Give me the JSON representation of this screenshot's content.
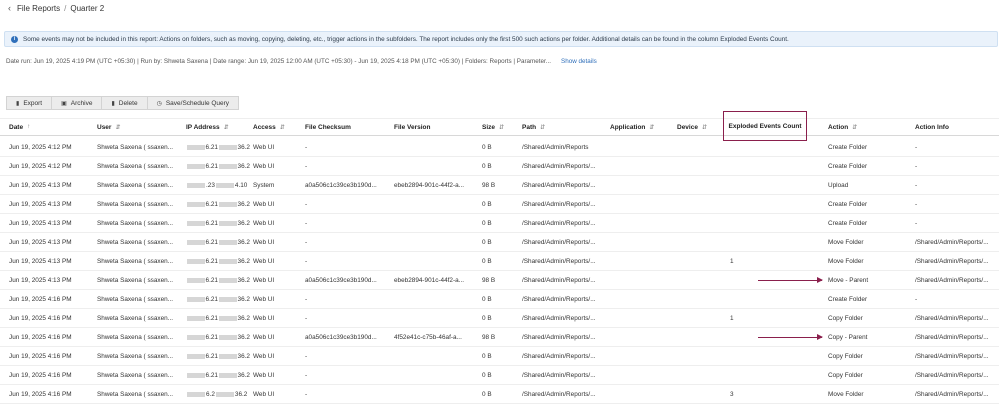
{
  "breadcrumb": {
    "back_icon": "chevron-left-icon",
    "parent": "File Reports",
    "separator": "/",
    "current": "Quarter 2"
  },
  "banner": {
    "icon": "info-icon",
    "text": "Some events may not be included in this report: Actions on folders, such as moving, copying, deleting, etc., trigger actions in the subfolders. The report includes only the first 500 such actions per folder. Additional details can be found in the column Exploded Events Count."
  },
  "run_info": {
    "text": "Date run: Jun 19, 2025 4:19 PM (UTC +05:30) | Run by: Shweta Saxena | Date range: Jun 19, 2025 12:00 AM (UTC +05:30) - Jun 19, 2025 4:18 PM (UTC +05:30) | Folders: Reports | Parameter...",
    "show_details": "Show details"
  },
  "toolbar": {
    "export": "Export",
    "archive": "Archive",
    "delete": "Delete",
    "save_schedule": "Save/Schedule Query"
  },
  "columns": {
    "date": "Date",
    "user": "User",
    "ip": "IP Address",
    "access": "Access",
    "checksum": "File Checksum",
    "version": "File Version",
    "size": "Size",
    "path": "Path",
    "application": "Application",
    "device": "Device",
    "exploded": "Exploded Events Count",
    "action": "Action",
    "action_info": "Action Info"
  },
  "rows": [
    {
      "date": "Jun 19, 2025 4:12 PM",
      "user": "Shweta Saxena ( ssaxen...",
      "ip_a": "6.21",
      "ip_b": "36.2",
      "access": "Web UI",
      "checksum": "-",
      "version": "",
      "size": "0 B",
      "path": "/Shared/Admin/Reports",
      "application": "",
      "device": "",
      "exploded": "",
      "action": "Create Folder",
      "action_info": "-"
    },
    {
      "date": "Jun 19, 2025 4:12 PM",
      "user": "Shweta Saxena ( ssaxen...",
      "ip_a": "6.21",
      "ip_b": "36.2",
      "access": "Web UI",
      "checksum": "-",
      "version": "",
      "size": "0 B",
      "path": "/Shared/Admin/Reports/...",
      "application": "",
      "device": "",
      "exploded": "",
      "action": "Create Folder",
      "action_info": "-"
    },
    {
      "date": "Jun 19, 2025 4:13 PM",
      "user": "Shweta Saxena ( ssaxen...",
      "ip_a": ".23",
      "ip_b": "4.10",
      "access": "System",
      "checksum": "a0a506c1c39ce3b190d...",
      "version": "ebeb2894-901c-44f2-a...",
      "size": "98 B",
      "path": "/Shared/Admin/Reports/...",
      "application": "",
      "device": "",
      "exploded": "",
      "action": "Upload",
      "action_info": "-"
    },
    {
      "date": "Jun 19, 2025 4:13 PM",
      "user": "Shweta Saxena ( ssaxen...",
      "ip_a": "6.21",
      "ip_b": "36.2",
      "access": "Web UI",
      "checksum": "-",
      "version": "",
      "size": "0 B",
      "path": "/Shared/Admin/Reports/...",
      "application": "",
      "device": "",
      "exploded": "",
      "action": "Create Folder",
      "action_info": "-"
    },
    {
      "date": "Jun 19, 2025 4:13 PM",
      "user": "Shweta Saxena ( ssaxen...",
      "ip_a": "6.21",
      "ip_b": "36.2",
      "access": "Web UI",
      "checksum": "-",
      "version": "",
      "size": "0 B",
      "path": "/Shared/Admin/Reports/...",
      "application": "",
      "device": "",
      "exploded": "",
      "action": "Create Folder",
      "action_info": "-"
    },
    {
      "date": "Jun 19, 2025 4:13 PM",
      "user": "Shweta Saxena ( ssaxen...",
      "ip_a": "6.21",
      "ip_b": "36.2",
      "access": "Web UI",
      "checksum": "-",
      "version": "",
      "size": "0 B",
      "path": "/Shared/Admin/Reports/...",
      "application": "",
      "device": "",
      "exploded": "",
      "action": "Move Folder",
      "action_info": "/Shared/Admin/Reports/..."
    },
    {
      "date": "Jun 19, 2025 4:13 PM",
      "user": "Shweta Saxena ( ssaxen...",
      "ip_a": "6.21",
      "ip_b": "36.2",
      "access": "Web UI",
      "checksum": "-",
      "version": "",
      "size": "0 B",
      "path": "/Shared/Admin/Reports/...",
      "application": "",
      "device": "",
      "exploded": "1",
      "action": "Move Folder",
      "action_info": "/Shared/Admin/Reports/..."
    },
    {
      "date": "Jun 19, 2025 4:13 PM",
      "user": "Shweta Saxena ( ssaxen...",
      "ip_a": "6.21",
      "ip_b": "36.2",
      "access": "Web UI",
      "checksum": "a0a506c1c39ce3b190d...",
      "version": "ebeb2894-901c-44f2-a...",
      "size": "98 B",
      "path": "/Shared/Admin/Reports/...",
      "application": "",
      "device": "",
      "exploded": "",
      "action": "Move - Parent",
      "action_info": "/Shared/Admin/Reports/..."
    },
    {
      "date": "Jun 19, 2025 4:16 PM",
      "user": "Shweta Saxena ( ssaxen...",
      "ip_a": "6.21",
      "ip_b": "36.2",
      "access": "Web UI",
      "checksum": "-",
      "version": "",
      "size": "0 B",
      "path": "/Shared/Admin/Reports/...",
      "application": "",
      "device": "",
      "exploded": "",
      "action": "Create Folder",
      "action_info": "-"
    },
    {
      "date": "Jun 19, 2025 4:16 PM",
      "user": "Shweta Saxena ( ssaxen...",
      "ip_a": "6.21",
      "ip_b": "36.2",
      "access": "Web UI",
      "checksum": "-",
      "version": "",
      "size": "0 B",
      "path": "/Shared/Admin/Reports/...",
      "application": "",
      "device": "",
      "exploded": "1",
      "action": "Copy Folder",
      "action_info": "/Shared/Admin/Reports/..."
    },
    {
      "date": "Jun 19, 2025 4:16 PM",
      "user": "Shweta Saxena ( ssaxen...",
      "ip_a": "6.21",
      "ip_b": "36.2",
      "access": "Web UI",
      "checksum": "a0a506c1c39ce3b190d...",
      "version": "4f52e41c-c75b-46af-a...",
      "size": "98 B",
      "path": "/Shared/Admin/Reports/...",
      "application": "",
      "device": "",
      "exploded": "",
      "action": "Copy - Parent",
      "action_info": "/Shared/Admin/Reports/..."
    },
    {
      "date": "Jun 19, 2025 4:16 PM",
      "user": "Shweta Saxena ( ssaxen...",
      "ip_a": "6.21",
      "ip_b": "36.2",
      "access": "Web UI",
      "checksum": "-",
      "version": "",
      "size": "0 B",
      "path": "/Shared/Admin/Reports/...",
      "application": "",
      "device": "",
      "exploded": "",
      "action": "Copy Folder",
      "action_info": "/Shared/Admin/Reports/..."
    },
    {
      "date": "Jun 19, 2025 4:16 PM",
      "user": "Shweta Saxena ( ssaxen...",
      "ip_a": "6.21",
      "ip_b": "36.2",
      "access": "Web UI",
      "checksum": "-",
      "version": "",
      "size": "0 B",
      "path": "/Shared/Admin/Reports/...",
      "application": "",
      "device": "",
      "exploded": "",
      "action": "Copy Folder",
      "action_info": "/Shared/Admin/Reports/..."
    },
    {
      "date": "Jun 19, 2025 4:16 PM",
      "user": "Shweta Saxena ( ssaxen...",
      "ip_a": "6.2",
      "ip_b": "36.2",
      "access": "Web UI",
      "checksum": "-",
      "version": "",
      "size": "0 B",
      "path": "/Shared/Admin/Reports/...",
      "application": "",
      "device": "",
      "exploded": "3",
      "action": "Move Folder",
      "action_info": "/Shared/Admin/Reports/..."
    }
  ],
  "annotation": {
    "color": "#8a1f4c",
    "arrow_rows": [
      7,
      10
    ]
  }
}
